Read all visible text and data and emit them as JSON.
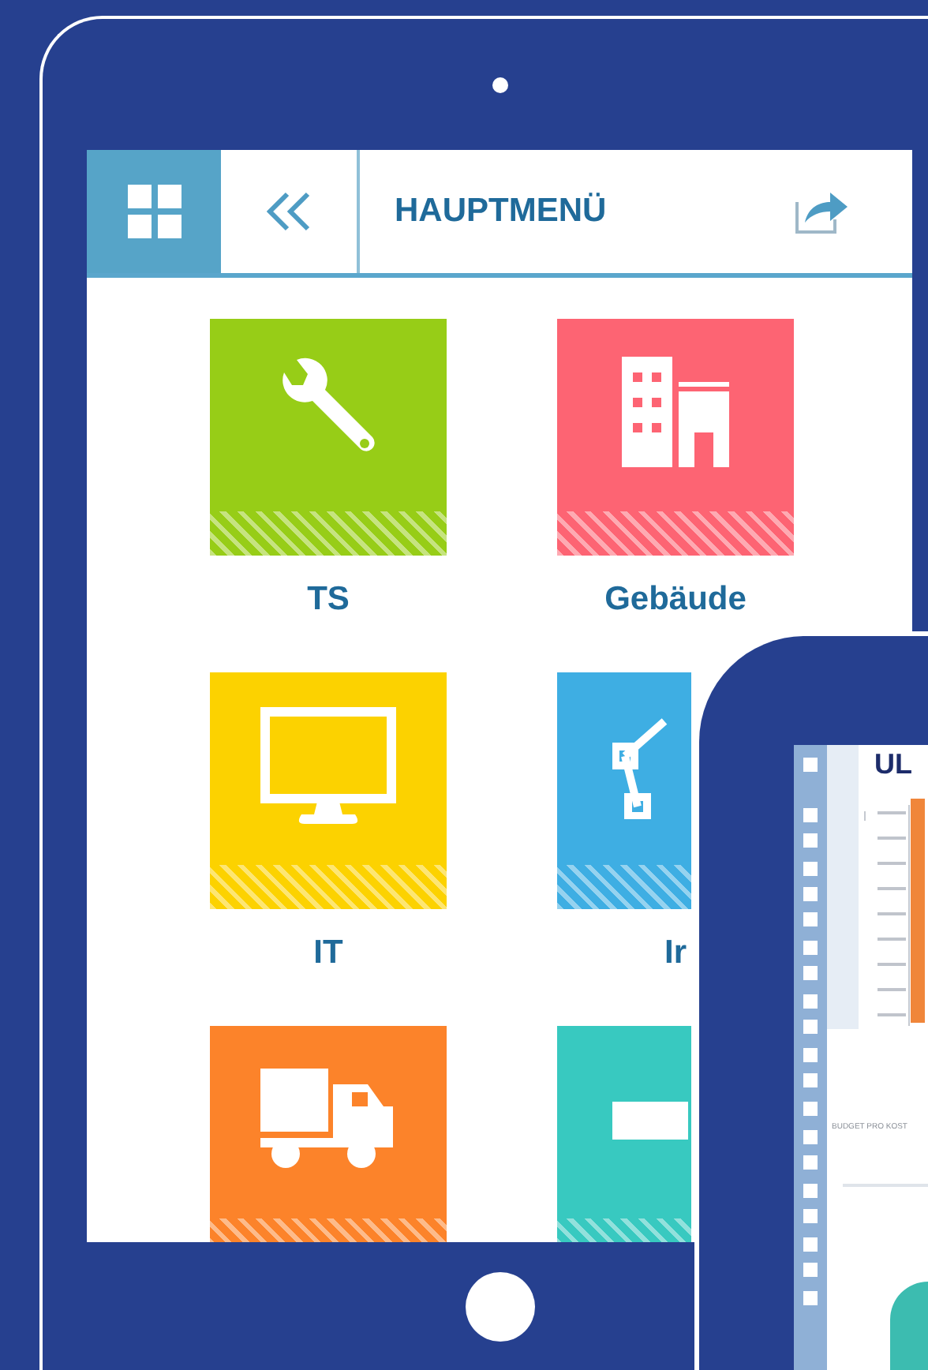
{
  "main_tablet": {
    "header": {
      "title": "HAUPTMENÜ"
    },
    "tiles": [
      {
        "label": "TS",
        "color": "#97cd17",
        "kind": "wrench"
      },
      {
        "label": "Gebäude",
        "color": "#fd6473",
        "kind": "building"
      },
      {
        "label": "IT",
        "color": "#fcd200",
        "kind": "monitor"
      },
      {
        "label": "Ir",
        "color": "#3eaee3",
        "kind": "network"
      },
      {
        "color": "#fc832a",
        "kind": "truck"
      },
      {
        "color": "#38c9c0",
        "kind": "box"
      }
    ]
  },
  "second_tablet": {
    "logo": "UL",
    "section_title": "BUDGET PRO KOST"
  }
}
